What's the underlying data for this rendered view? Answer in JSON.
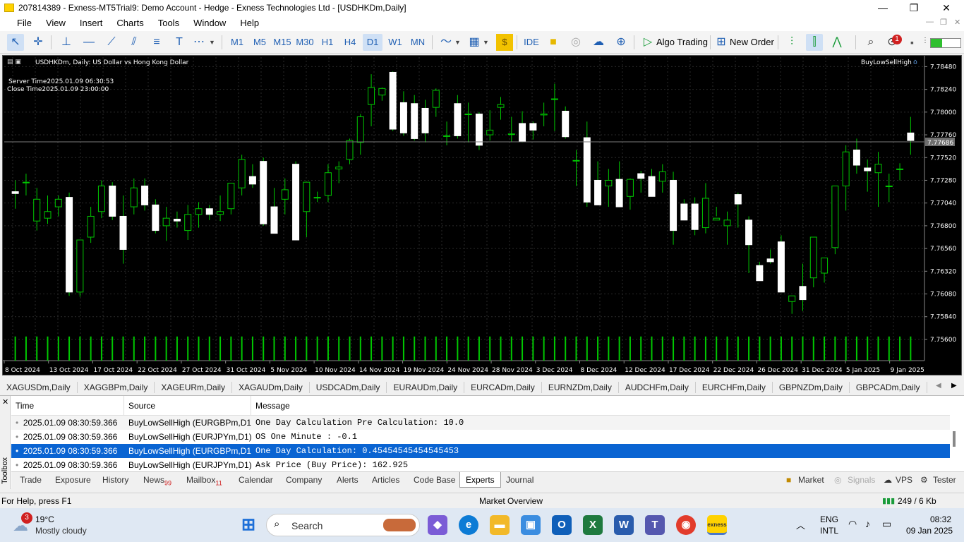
{
  "window": {
    "title": "207814389 - Exness-MT5Trial9: Demo Account - Hedge - Exness Technologies Ltd - [USDHKDm,Daily]",
    "controls": [
      "—",
      "❐",
      "✕"
    ]
  },
  "menu": [
    "File",
    "View",
    "Insert",
    "Charts",
    "Tools",
    "Window",
    "Help"
  ],
  "toolbar": {
    "timeframes": [
      "M1",
      "M5",
      "M15",
      "M30",
      "H1",
      "H4",
      "D1",
      "W1",
      "MN"
    ],
    "selected_timeframe": "D1",
    "ide_label": "IDE",
    "algo_label": "Algo Trading",
    "order_label": "New Order",
    "notification_count": "1"
  },
  "chart": {
    "header": "USDHKDm, Daily:  US Dollar vs Hong Kong Dollar",
    "server_time": "Server Time2025.01.09 06:30:53",
    "close_time": "Close Time2025.01.09 23:00:00",
    "expert": "BuyLowSellHigh",
    "current_price": "7.77686",
    "colors": {
      "background": "#000000",
      "bull": "#00c800",
      "bear_body": "#ffffff",
      "grid": "#333333",
      "current_line": "#7a7a7a"
    }
  },
  "chart_data": {
    "type": "candlestick",
    "symbol": "USDHKDm",
    "timeframe": "Daily",
    "x_tick_labels": [
      "8 Oct 2024",
      "13 Oct 2024",
      "17 Oct 2024",
      "22 Oct 2024",
      "27 Oct 2024",
      "31 Oct 2024",
      "5 Nov 2024",
      "10 Nov 2024",
      "14 Nov 2024",
      "19 Nov 2024",
      "24 Nov 2024",
      "28 Nov 2024",
      "3 Dec 2024",
      "8 Dec 2024",
      "12 Dec 2024",
      "17 Dec 2024",
      "22 Dec 2024",
      "26 Dec 2024",
      "31 Dec 2024",
      "5 Jan 2025",
      "9 Jan 2025"
    ],
    "y_tick_labels": [
      "7.78480",
      "7.78240",
      "7.78000",
      "7.77760",
      "7.77520",
      "7.77280",
      "7.77040",
      "7.76800",
      "7.76560",
      "7.76320",
      "7.76080",
      "7.75840",
      "7.75600"
    ],
    "ylim": [
      7.7554,
      7.7858
    ],
    "current_price": 7.77686,
    "candles": [
      [
        7.7716,
        7.7728,
        7.7698,
        7.7714
      ],
      [
        7.7726,
        7.7735,
        7.7712,
        7.7726
      ],
      [
        7.7685,
        7.772,
        7.7675,
        7.7708
      ],
      [
        7.7688,
        7.7712,
        7.7682,
        7.7695
      ],
      [
        7.77,
        7.7712,
        7.769,
        7.7708
      ],
      [
        7.771,
        7.7715,
        7.7606,
        7.761
      ],
      [
        7.761,
        7.7665,
        7.7605,
        7.7665
      ],
      [
        7.7668,
        7.77,
        7.7662,
        7.769
      ],
      [
        7.7695,
        7.7728,
        7.7688,
        7.7722
      ],
      [
        7.7722,
        7.7726,
        7.7686,
        7.769
      ],
      [
        7.769,
        7.7712,
        7.764,
        7.7655
      ],
      [
        7.77,
        7.773,
        7.7692,
        7.772
      ],
      [
        7.7722,
        7.773,
        7.7696,
        7.7702
      ],
      [
        7.7702,
        7.7708,
        7.7672,
        7.7675
      ],
      [
        7.768,
        7.77,
        7.7664,
        7.7688
      ],
      [
        7.7687,
        7.7695,
        7.7678,
        7.7685
      ],
      [
        7.7675,
        7.7702,
        7.7665,
        7.7692
      ],
      [
        7.7692,
        7.7705,
        7.7678,
        7.7698
      ],
      [
        7.7698,
        7.7702,
        7.7686,
        7.7692
      ],
      [
        7.7692,
        7.7712,
        7.7685,
        7.7695
      ],
      [
        7.7698,
        7.7725,
        7.7692,
        7.7725
      ],
      [
        7.772,
        7.7755,
        7.7712,
        7.775
      ],
      [
        7.7732,
        7.7745,
        7.772,
        7.7724
      ],
      [
        7.7748,
        7.7752,
        7.768,
        7.7682
      ],
      [
        7.77,
        7.772,
        7.7672,
        7.7672
      ],
      [
        7.7708,
        7.773,
        7.7692,
        7.7718
      ],
      [
        7.7745,
        7.7748,
        7.7665,
        7.7665
      ],
      [
        7.7695,
        7.7725,
        7.7668,
        7.7726
      ],
      [
        7.771,
        7.7716,
        7.7705,
        7.771
      ],
      [
        7.7712,
        7.7745,
        7.7705,
        7.7736
      ],
      [
        7.774,
        7.7748,
        7.7725,
        7.7742
      ],
      [
        7.775,
        7.7772,
        7.7745,
        7.777
      ],
      [
        7.7768,
        7.7798,
        7.7755,
        7.7795
      ],
      [
        7.7808,
        7.784,
        7.7785,
        7.7826
      ],
      [
        7.7818,
        7.7826,
        7.7812,
        7.7825
      ],
      [
        7.7842,
        7.7843,
        7.778,
        7.7782
      ],
      [
        7.781,
        7.7822,
        7.7775,
        7.7778
      ],
      [
        7.7809,
        7.7818,
        7.777,
        7.7772
      ],
      [
        7.7804,
        7.7813,
        7.7768,
        7.7778
      ],
      [
        7.7805,
        7.7825,
        7.7795,
        7.7823
      ],
      [
        7.7775,
        7.779,
        7.7765,
        7.7775
      ],
      [
        7.7809,
        7.7818,
        7.7772,
        7.7775
      ],
      [
        7.7798,
        7.781,
        7.7768,
        7.7798
      ],
      [
        7.7798,
        7.78,
        7.776,
        7.7765
      ],
      [
        7.7776,
        7.7802,
        7.777,
        7.7781
      ],
      [
        7.7805,
        7.7816,
        7.7792,
        7.7808
      ],
      [
        7.7777,
        7.7795,
        7.7769,
        7.7777
      ],
      [
        7.7788,
        7.7801,
        7.7768,
        7.7769
      ],
      [
        7.7788,
        7.779,
        7.7771,
        7.7781
      ],
      [
        7.7797,
        7.781,
        7.7785,
        7.7798
      ],
      [
        7.7814,
        7.783,
        7.778,
        7.7814
      ],
      [
        7.7801,
        7.7806,
        7.7772,
        7.7774
      ],
      [
        7.7749,
        7.776,
        7.7722,
        7.7749
      ],
      [
        7.7773,
        7.779,
        7.77,
        7.7705
      ],
      [
        7.7728,
        7.7748,
        7.7703,
        7.7702
      ],
      [
        7.7722,
        7.774,
        7.77,
        7.7728
      ],
      [
        7.7729,
        7.7748,
        7.7709,
        7.77
      ],
      [
        7.7711,
        7.773,
        7.7697,
        7.7729
      ],
      [
        7.7735,
        7.7738,
        7.7715,
        7.773
      ],
      [
        7.7732,
        7.774,
        7.7715,
        7.7711
      ],
      [
        7.7727,
        7.7745,
        7.7715,
        7.7737
      ],
      [
        7.7728,
        7.7737,
        7.766,
        7.7675
      ],
      [
        7.7703,
        7.7708,
        7.77,
        7.7686
      ],
      [
        7.7703,
        7.771,
        7.767,
        7.7676
      ],
      [
        7.7678,
        7.7725,
        7.7672,
        7.7709
      ],
      [
        7.7686,
        7.77,
        7.769,
        7.7688
      ],
      [
        7.768,
        7.7695,
        7.766,
        7.7686
      ],
      [
        7.7713,
        7.7715,
        7.7678,
        7.7703
      ],
      [
        7.7686,
        7.769,
        7.763,
        7.766
      ],
      [
        7.7638,
        7.7642,
        7.7622,
        7.7622
      ],
      [
        7.7645,
        7.7655,
        7.764,
        7.7642
      ],
      [
        7.7663,
        7.767,
        7.7612,
        7.761
      ],
      [
        7.76,
        7.7606,
        7.7587,
        7.7606
      ],
      [
        7.7616,
        7.764,
        7.759,
        7.7602
      ],
      [
        7.7625,
        7.765,
        7.7615,
        7.7668
      ],
      [
        7.763,
        7.764,
        7.762,
        7.7646
      ],
      [
        7.7657,
        7.7665,
        7.765,
        7.7722
      ],
      [
        7.7722,
        7.7765,
        7.7696,
        7.7758
      ],
      [
        7.776,
        7.7772,
        7.7735,
        7.7744
      ],
      [
        7.7741,
        7.775,
        7.7716,
        7.7738
      ],
      [
        7.7736,
        7.7758,
        7.77,
        7.7745
      ],
      [
        7.7722,
        7.7735,
        7.7705,
        7.7722
      ],
      [
        7.774,
        7.7746,
        7.7728,
        7.774
      ],
      [
        7.7778,
        7.7795,
        7.7755,
        7.777
      ]
    ],
    "volumes": [
      38,
      38,
      38,
      38,
      38,
      38,
      38,
      38,
      38,
      38,
      38,
      38,
      38,
      38,
      38,
      38,
      38,
      38,
      38,
      38,
      38,
      38,
      38,
      38,
      38,
      38,
      38,
      38,
      38,
      38,
      38,
      38,
      38,
      38,
      38,
      38,
      38,
      38,
      38,
      38,
      38,
      38,
      38,
      38,
      38,
      38,
      38,
      38,
      38,
      38,
      38,
      38,
      38,
      38,
      38,
      38,
      38,
      38,
      38,
      38,
      38,
      38,
      38,
      38,
      38,
      38,
      38,
      38,
      38,
      38,
      38,
      38,
      38,
      38,
      38,
      38,
      38,
      38,
      38,
      38,
      38,
      38,
      38,
      38,
      38
    ],
    "xlabel": "",
    "ylabel": ""
  },
  "symbol_tabs": [
    "XAGUSDm,Daily",
    "XAGGBPm,Daily",
    "XAGEURm,Daily",
    "XAGAUDm,Daily",
    "USDCADm,Daily",
    "EURAUDm,Daily",
    "EURCADm,Daily",
    "EURNZDm,Daily",
    "AUDCHFm,Daily",
    "EURCHFm,Daily",
    "GBPNZDm,Daily",
    "GBPCADm,Daily"
  ],
  "toolbox": {
    "side_label": "Toolbox",
    "columns": [
      "Time",
      "Source",
      "Message"
    ],
    "rows": [
      {
        "time": "2025.01.09 08:30:59.366",
        "source": "BuyLowSellHigh (EURGBPm,D1)",
        "message": "One Day Calculation Pre Calculation: 10.0"
      },
      {
        "time": "2025.01.09 08:30:59.366",
        "source": "BuyLowSellHigh (EURJPYm,D1)",
        "message": "OS One Minute : -0.1"
      },
      {
        "time": "2025.01.09 08:30:59.366",
        "source": "BuyLowSellHigh (EURGBPm,D1)",
        "message": "One Day Calculation: 0.45454545454545453"
      },
      {
        "time": "2025.01.09 08:30:59.366",
        "source": "BuyLowSellHigh (EURJPYm,D1)",
        "message": "Ask Price (Buy Price): 162.925"
      }
    ],
    "selected_row": 2,
    "tabs": {
      "trade": "Trade",
      "exposure": "Exposure",
      "history": "History",
      "news": "News",
      "news_count": "99",
      "mailbox": "Mailbox",
      "mailbox_count": "11",
      "calendar": "Calendar",
      "company": "Company",
      "alerts": "Alerts",
      "articles": "Articles",
      "codebase": "Code Base",
      "experts": "Experts",
      "journal": "Journal"
    },
    "right_tabs": {
      "market": "Market",
      "signals": "Signals",
      "vps": "VPS",
      "tester": "Tester"
    }
  },
  "statusbar": {
    "help": "For Help, press F1",
    "profile": "Market Overview",
    "traffic": "249 / 6 Kb"
  },
  "taskbar": {
    "weather_temp": "19°C",
    "weather_desc": "Mostly cloudy",
    "weather_badge": "3",
    "search_placeholder": "Search",
    "lang1": "ENG",
    "lang2": "INTL",
    "time": "08:32",
    "date": "09 Jan 2025"
  }
}
